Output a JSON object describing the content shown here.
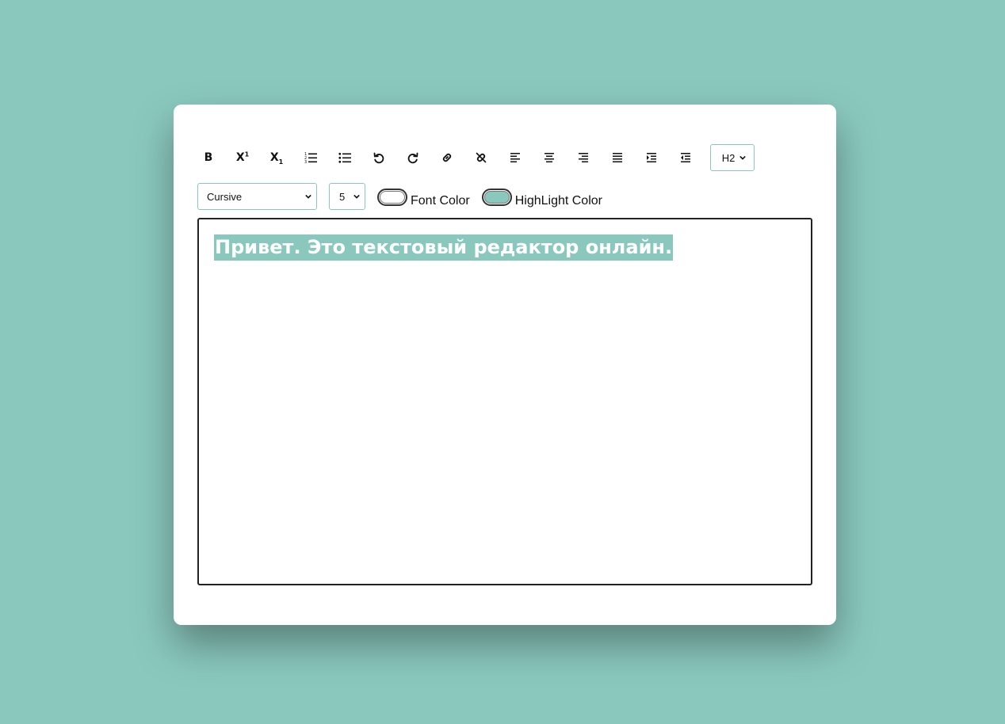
{
  "colors": {
    "page_background": "#8ac8be",
    "card_background": "#ffffff",
    "accent": "#8ac8be",
    "font_color": "#ffffff",
    "highlight_color": "#8ac8be"
  },
  "toolbar": {
    "buttons": [
      {
        "name": "bold",
        "icon": "bold-icon",
        "glyph": "B"
      },
      {
        "name": "superscript",
        "icon": "superscript-icon",
        "glyph": "X",
        "mark": "1"
      },
      {
        "name": "subscript",
        "icon": "subscript-icon",
        "glyph": "X",
        "mark": "1"
      },
      {
        "name": "ordered-list",
        "icon": "ordered-list-icon"
      },
      {
        "name": "unordered-list",
        "icon": "unordered-list-icon"
      },
      {
        "name": "undo",
        "icon": "undo-icon"
      },
      {
        "name": "redo",
        "icon": "redo-icon"
      },
      {
        "name": "link",
        "icon": "link-icon"
      },
      {
        "name": "unlink",
        "icon": "unlink-icon"
      },
      {
        "name": "align-left",
        "icon": "align-left-icon"
      },
      {
        "name": "align-center",
        "icon": "align-center-icon"
      },
      {
        "name": "align-right",
        "icon": "align-right-icon"
      },
      {
        "name": "justify",
        "icon": "align-justify-icon"
      },
      {
        "name": "indent",
        "icon": "indent-icon"
      },
      {
        "name": "outdent",
        "icon": "outdent-icon"
      }
    ],
    "heading_select": {
      "selected": "H2"
    },
    "font_select": {
      "selected": "Cursive"
    },
    "size_select": {
      "selected": "5"
    },
    "font_color_label": "Font Color",
    "highlight_color_label": "HighLight Color"
  },
  "editor": {
    "content": "Привет. Это текстовый редактор онлайн."
  }
}
